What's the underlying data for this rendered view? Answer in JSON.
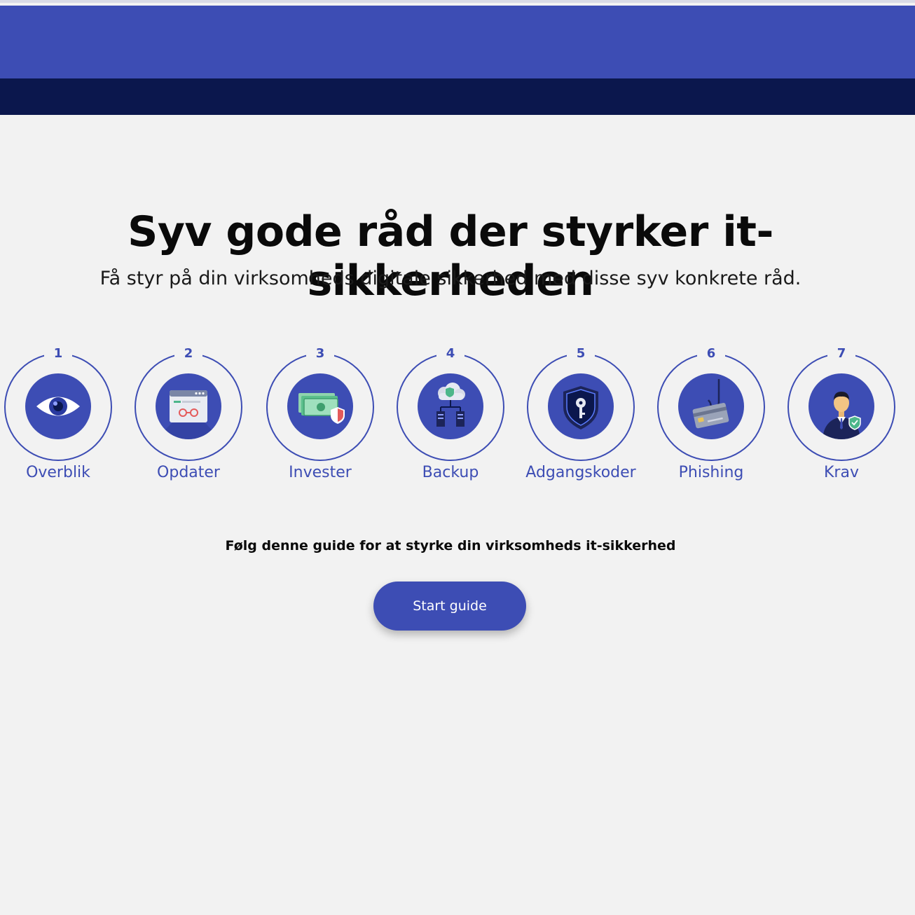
{
  "colors": {
    "brand_blue": "#3d4db4",
    "dark_navy": "#0b174d",
    "background": "#f2f2f2"
  },
  "hero": {
    "title": "Syv gode råd der styrker it-sikkerheden",
    "subtitle": "Få styr på din virksomheds digitale sikkerhed med disse syv konkrete råd."
  },
  "steps": [
    {
      "number": "1",
      "label": "Overblik",
      "icon": "eye-icon"
    },
    {
      "number": "2",
      "label": "Opdater",
      "icon": "browser-update-icon"
    },
    {
      "number": "3",
      "label": "Invester",
      "icon": "money-shield-icon"
    },
    {
      "number": "4",
      "label": "Backup",
      "icon": "cloud-backup-icon"
    },
    {
      "number": "5",
      "label": "Adgangskoder",
      "icon": "key-shield-icon"
    },
    {
      "number": "6",
      "label": "Phishing",
      "icon": "card-hook-icon"
    },
    {
      "number": "7",
      "label": "Krav",
      "icon": "businessman-shield-icon"
    }
  ],
  "guide": {
    "text": "Følg denne guide for at styrke din virksomheds it-sikkerhed",
    "button_label": "Start guide"
  }
}
